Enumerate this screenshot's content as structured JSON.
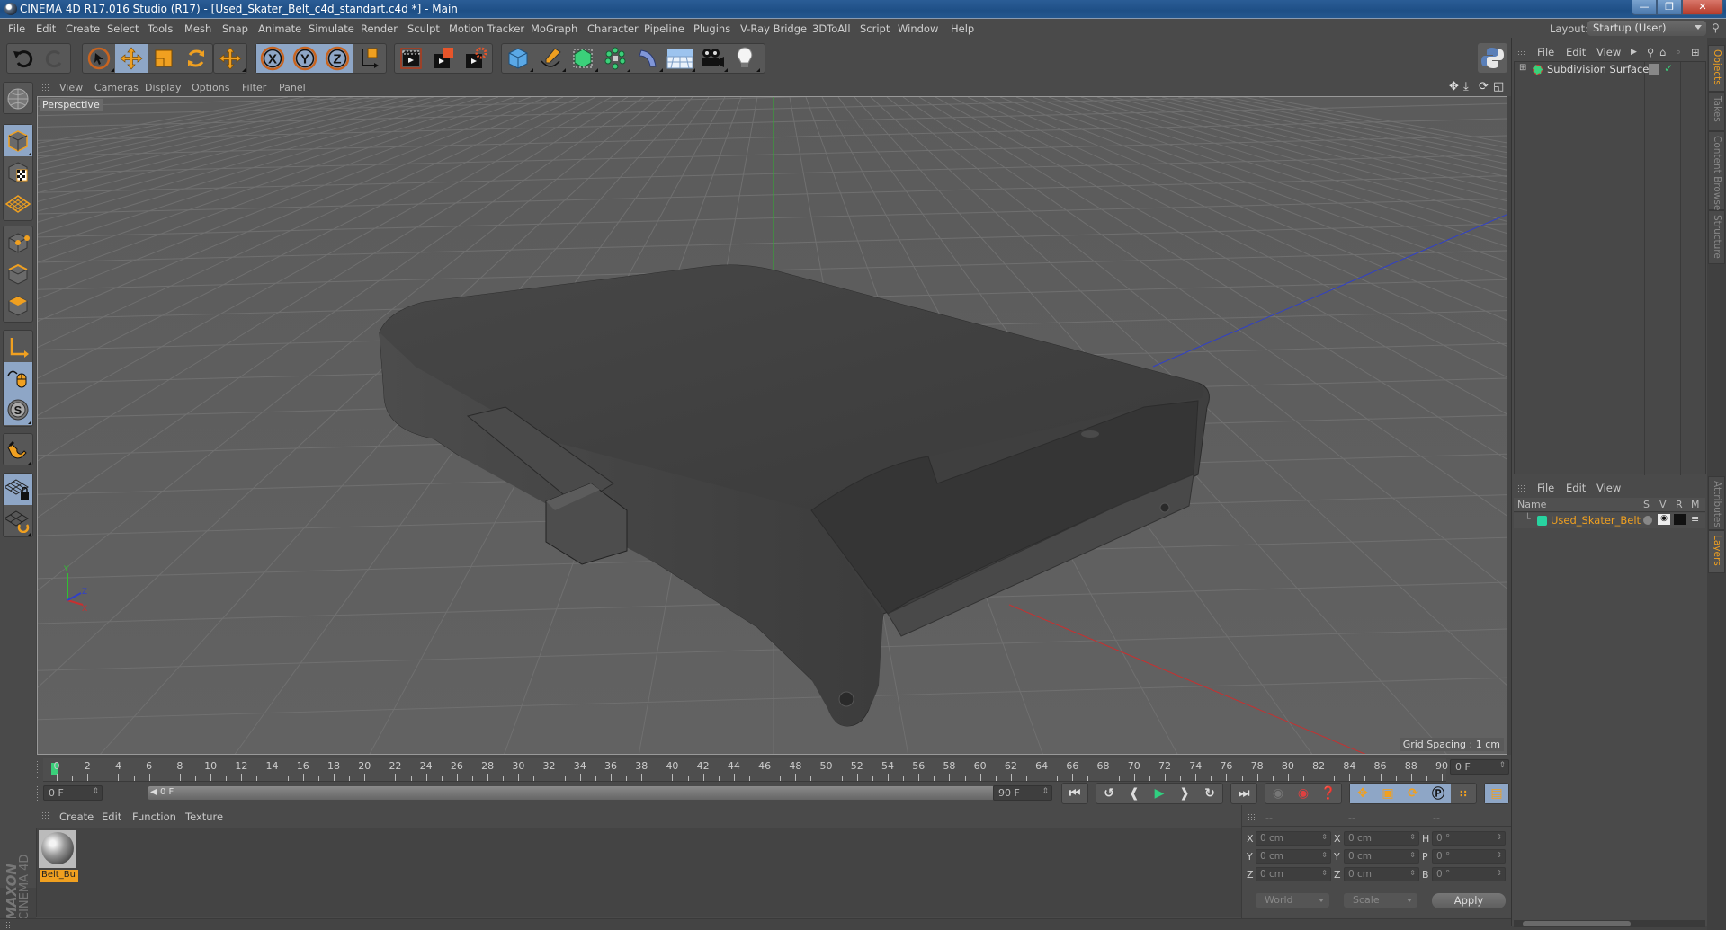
{
  "window": {
    "title": "CINEMA 4D R17.016 Studio (R17) - [Used_Skater_Belt_c4d_standart.c4d *] - Main",
    "controls": [
      "minimize",
      "restore",
      "close"
    ]
  },
  "menubar": {
    "items": [
      "File",
      "Edit",
      "Create",
      "Select",
      "Tools",
      "Mesh",
      "Snap",
      "Animate",
      "Simulate",
      "Render",
      "Sculpt",
      "Motion Tracker",
      "MoGraph",
      "Character",
      "Pipeline",
      "Plugins",
      "V-Ray Bridge",
      "3DToAll",
      "Script",
      "Window",
      "Help"
    ],
    "layout_label": "Layout:",
    "layout_value": "Startup (User)"
  },
  "toolbar": {
    "groups": [
      [
        "undo-icon",
        "redo-icon"
      ],
      [
        "select-live-icon",
        "move-icon",
        "scale-icon",
        "rotate-icon"
      ],
      [
        "recent-tool-icon"
      ],
      [
        "x-axis-lock-icon",
        "y-axis-lock-icon",
        "z-axis-lock-icon",
        "coordinate-system-icon"
      ],
      [
        "render-view-icon",
        "render-picture-viewer-icon",
        "edit-render-settings-icon"
      ],
      [
        "cube-icon",
        "pen-spline-icon",
        "subdivision-surface-icon",
        "array-icon",
        "deformer-icon",
        "floor-icon",
        "camera-icon",
        "light-icon"
      ]
    ]
  },
  "left_tools": [
    "make-editable-icon",
    "model-mode-icon",
    "texture-mode-icon",
    "workplane-mode-icon",
    "points-mode-icon",
    "edges-mode-icon",
    "polygons-mode-icon",
    "axis-mode-icon",
    "tweak-mode-icon",
    "solo-icon",
    "snap-icon",
    "workplane-lock-icon",
    "workplane-align-icon"
  ],
  "viewport": {
    "menu": [
      "View",
      "Cameras",
      "Display",
      "Options",
      "Filter",
      "Panel"
    ],
    "camera_label": "Perspective",
    "grid_spacing": "Grid Spacing : 1 cm",
    "axis_labels": {
      "y": "Y",
      "x": "X",
      "z": "Z"
    }
  },
  "timeline": {
    "ticks": [
      "0",
      "2",
      "4",
      "6",
      "8",
      "10",
      "12",
      "14",
      "16",
      "18",
      "20",
      "22",
      "24",
      "26",
      "28",
      "30",
      "32",
      "34",
      "36",
      "38",
      "40",
      "42",
      "44",
      "46",
      "48",
      "50",
      "52",
      "54",
      "56",
      "58",
      "60",
      "62",
      "64",
      "66",
      "68",
      "70",
      "72",
      "74",
      "76",
      "78",
      "80",
      "82",
      "84",
      "86",
      "88",
      "90"
    ],
    "current_frame": "0 F",
    "start_frame": "0 F",
    "range_start": "0 F",
    "range_end": "90 F",
    "end_frame": "90 F"
  },
  "playback": {
    "controls": [
      "go-to-start-icon",
      "previous-key-icon",
      "previous-frame-icon",
      "play-icon",
      "next-frame-icon",
      "next-key-icon",
      "go-to-end-icon"
    ],
    "keyframe": [
      "autokey-disabled-icon",
      "record-icon",
      "autokey-icon"
    ],
    "key_types": [
      "key-position-icon",
      "key-scale-icon",
      "key-rotation-icon",
      "key-parameter-icon",
      "key-pla-icon"
    ],
    "timeline_button": "timeline-icon"
  },
  "material_manager": {
    "menu": [
      "Create",
      "Edit",
      "Function",
      "Texture"
    ],
    "materials": [
      {
        "name": "Belt_Bu"
      }
    ]
  },
  "branding": {
    "maxon": "MAXON",
    "product": "CINEMA 4D"
  },
  "coordinates": {
    "headers": [
      "--",
      "--",
      "--"
    ],
    "rows": [
      {
        "a1": "X",
        "v1": "0 cm",
        "a2": "X",
        "v2": "0 cm",
        "a3": "H",
        "v3": "0 °"
      },
      {
        "a1": "Y",
        "v1": "0 cm",
        "a2": "Y",
        "v2": "0 cm",
        "a3": "P",
        "v3": "0 °"
      },
      {
        "a1": "Z",
        "v1": "0 cm",
        "a2": "Z",
        "v2": "0 cm",
        "a3": "B",
        "v3": "0 °"
      }
    ],
    "space": "World",
    "mode": "Scale",
    "apply": "Apply"
  },
  "object_manager": {
    "menu": [
      "File",
      "Edit",
      "View"
    ],
    "objects": [
      {
        "name": "Subdivision Surface"
      }
    ]
  },
  "layer_manager": {
    "menu": [
      "File",
      "Edit",
      "View"
    ],
    "columns": [
      "Name",
      "S",
      "V",
      "R",
      "M"
    ],
    "layers": [
      {
        "name": "Used_Skater_Belt",
        "color": "#28d3a0"
      }
    ]
  },
  "side_tabs": {
    "top": [
      "Objects",
      "Takes",
      "Content Browser",
      "Structure"
    ],
    "bottom": [
      "Attributes",
      "Layers"
    ]
  },
  "colors": {
    "accent_orange": "#f0a020",
    "active_blue": "#8ea6c6",
    "playhead_green": "#3ad07a",
    "axis_x": "#c83030",
    "axis_y": "#30c030",
    "axis_z": "#3040c8"
  }
}
